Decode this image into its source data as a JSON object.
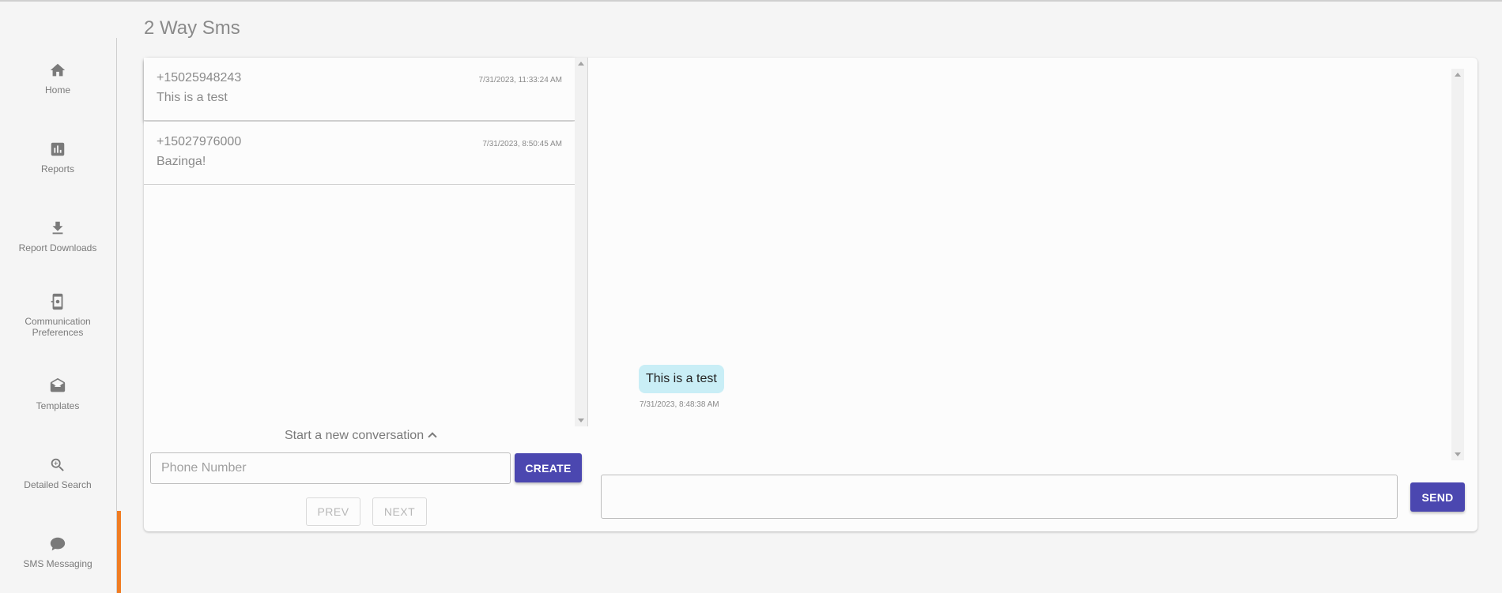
{
  "page": {
    "title": "2 Way Sms"
  },
  "sidebar": {
    "items": [
      {
        "label": "Home",
        "icon": "home-icon"
      },
      {
        "label": "Reports",
        "icon": "bar-chart-icon"
      },
      {
        "label": "Report Downloads",
        "icon": "download-icon"
      },
      {
        "label": "Communication Preferences",
        "icon": "phone-settings-icon"
      },
      {
        "label": "Templates",
        "icon": "mail-template-icon"
      },
      {
        "label": "Detailed Search",
        "icon": "zoom-in-icon"
      },
      {
        "label": "SMS Messaging",
        "icon": "chat-bubble-icon",
        "active": true
      }
    ],
    "active_color": "#f07c22"
  },
  "conversations": [
    {
      "phone": "+15025948243",
      "message": "This is a test",
      "time": "7/31/2023, 11:33:24 AM",
      "selected": true
    },
    {
      "phone": "+15027976000",
      "message": "Bazinga!",
      "time": "7/31/2023, 8:50:45 AM",
      "selected": false
    }
  ],
  "new_conversation": {
    "label": "Start a new conversation",
    "phone_placeholder": "Phone Number",
    "create_label": "CREATE"
  },
  "pagination": {
    "prev_label": "PREV",
    "next_label": "NEXT"
  },
  "messages": [
    {
      "text": "This is a test",
      "time": "7/31/2023, 8:48:38 AM"
    }
  ],
  "composer": {
    "value": "",
    "send_label": "SEND"
  },
  "colors": {
    "primary": "#4b47b0",
    "bubble": "#c9eef6"
  }
}
